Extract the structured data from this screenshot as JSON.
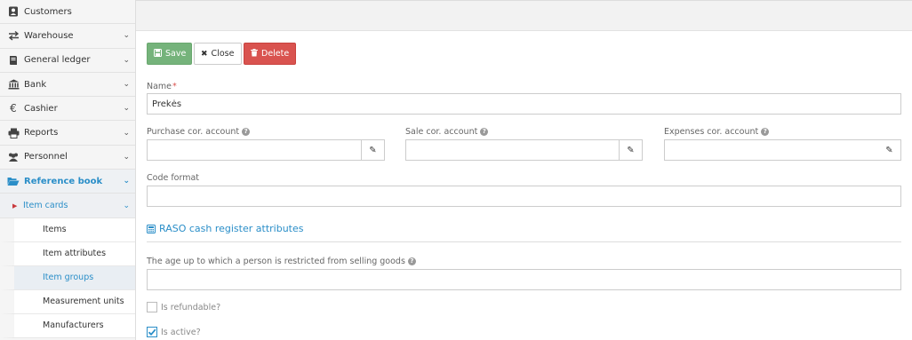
{
  "sidebar": {
    "items": [
      {
        "label": "Customers",
        "icon": "address-book-icon"
      },
      {
        "label": "Warehouse",
        "icon": "transfer-arrows-icon"
      },
      {
        "label": "General ledger",
        "icon": "book-icon"
      },
      {
        "label": "Bank",
        "icon": "bank-icon"
      },
      {
        "label": "Cashier",
        "icon": "euro-icon"
      },
      {
        "label": "Reports",
        "icon": "printer-icon"
      },
      {
        "label": "Personnel",
        "icon": "users-icon"
      },
      {
        "label": "Reference book",
        "icon": "folder-open-icon"
      }
    ],
    "submenu": {
      "label": "Item cards"
    },
    "leaves": [
      "Items",
      "Item attributes",
      "Item groups",
      "Measurement units",
      "Manufacturers"
    ]
  },
  "toolbar": {
    "save_label": "Save",
    "close_label": "Close",
    "delete_label": "Delete"
  },
  "form": {
    "name_label": "Name",
    "name_value": "Prekės",
    "purchase_label": "Purchase cor. account",
    "sale_label": "Sale cor. account",
    "expenses_label": "Expenses cor. account",
    "code_format_label": "Code format",
    "raso_link": "RASO cash register attributes",
    "age_label": "The age up to which a person is restricted from selling goods",
    "refundable_label": "Is refundable?",
    "active_label": "Is active?",
    "refundable_checked": false,
    "active_checked": true
  },
  "colors": {
    "accent": "#2a8ec8",
    "save": "#75b37b",
    "delete": "#d9534f"
  }
}
